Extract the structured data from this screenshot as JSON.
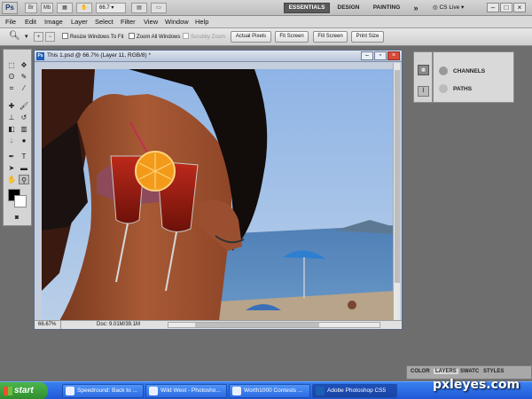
{
  "appbar": {
    "logo": "Ps",
    "zoom": "66.7",
    "workspaces": [
      "ESSENTIALS",
      "DESIGN",
      "PAINTING"
    ],
    "more": "»",
    "cs_live": "CS Live",
    "window_controls": [
      "–",
      "□",
      "×"
    ]
  },
  "menubar": {
    "items": [
      "File",
      "Edit",
      "Image",
      "Layer",
      "Select",
      "Filter",
      "View",
      "Window",
      "Help"
    ]
  },
  "options": {
    "resize_windows": "Resize Windows To Fit",
    "zoom_all": "Zoom All Windows",
    "scrubby_zoom": "Scrubby Zoom",
    "actual_pixels": "Actual Pixels",
    "fit_screen": "Fit Screen",
    "fill_screen": "Fill Screen",
    "print_size": "Print Size"
  },
  "document": {
    "title": "This 1.psd @ 66.7% (Layer 11, RGB/8) *",
    "zoom_status": "66.67%",
    "doc_info": "Doc: 9.01M/39.1M"
  },
  "panels": {
    "channels": "CHANNELS",
    "paths": "PATHS"
  },
  "layers_tabs": [
    "COLOR",
    "LAYERS",
    "SWATC",
    "STYLES"
  ],
  "taskbar": {
    "start": "start",
    "items": [
      "Speedround: Back to ...",
      "Wild West - Photosho...",
      "Worth1000 Contests ...",
      "Adobe Photoshop CS5"
    ]
  },
  "watermark": "pxleyes.com",
  "colors": {
    "workspace_bg": "#6e6e6e",
    "taskbar_blue": "#2463e0",
    "start_green": "#3a9e3a",
    "drink_red": "#8e1a10",
    "sky": "#8ab4e0",
    "sea": "#4a78a8"
  }
}
